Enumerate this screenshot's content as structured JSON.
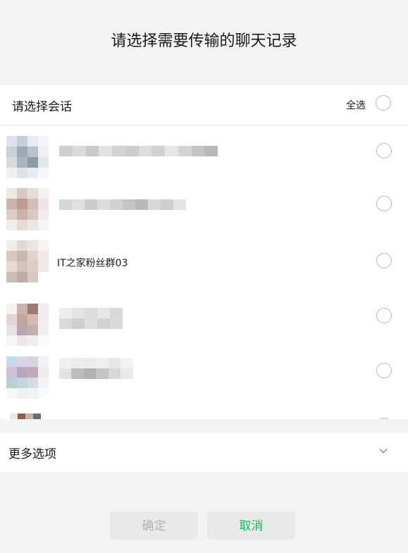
{
  "dialog": {
    "title": "请选择需要传输的聊天记录"
  },
  "session_panel": {
    "header_label": "请选择会话",
    "select_all_label": "全选",
    "select_all_checked": false
  },
  "sessions": [
    {
      "name": "",
      "blurred": true,
      "checked": false
    },
    {
      "name": "",
      "blurred": true,
      "checked": false
    },
    {
      "name": "IT之家粉丝群03",
      "blurred": false,
      "checked": false
    },
    {
      "name": "",
      "blurred": true,
      "checked": false
    },
    {
      "name": "",
      "blurred": true,
      "checked": false
    },
    {
      "name": "",
      "blurred": true,
      "checked": false
    }
  ],
  "more_options": {
    "label": "更多选项",
    "expanded": false,
    "icon": "chevron-down-icon"
  },
  "buttons": {
    "confirm_label": "确定",
    "confirm_enabled": false,
    "cancel_label": "取消"
  },
  "colors": {
    "accent_green": "#07c160",
    "disabled_text": "#b3b3b3",
    "background": "#f3f3f3"
  }
}
